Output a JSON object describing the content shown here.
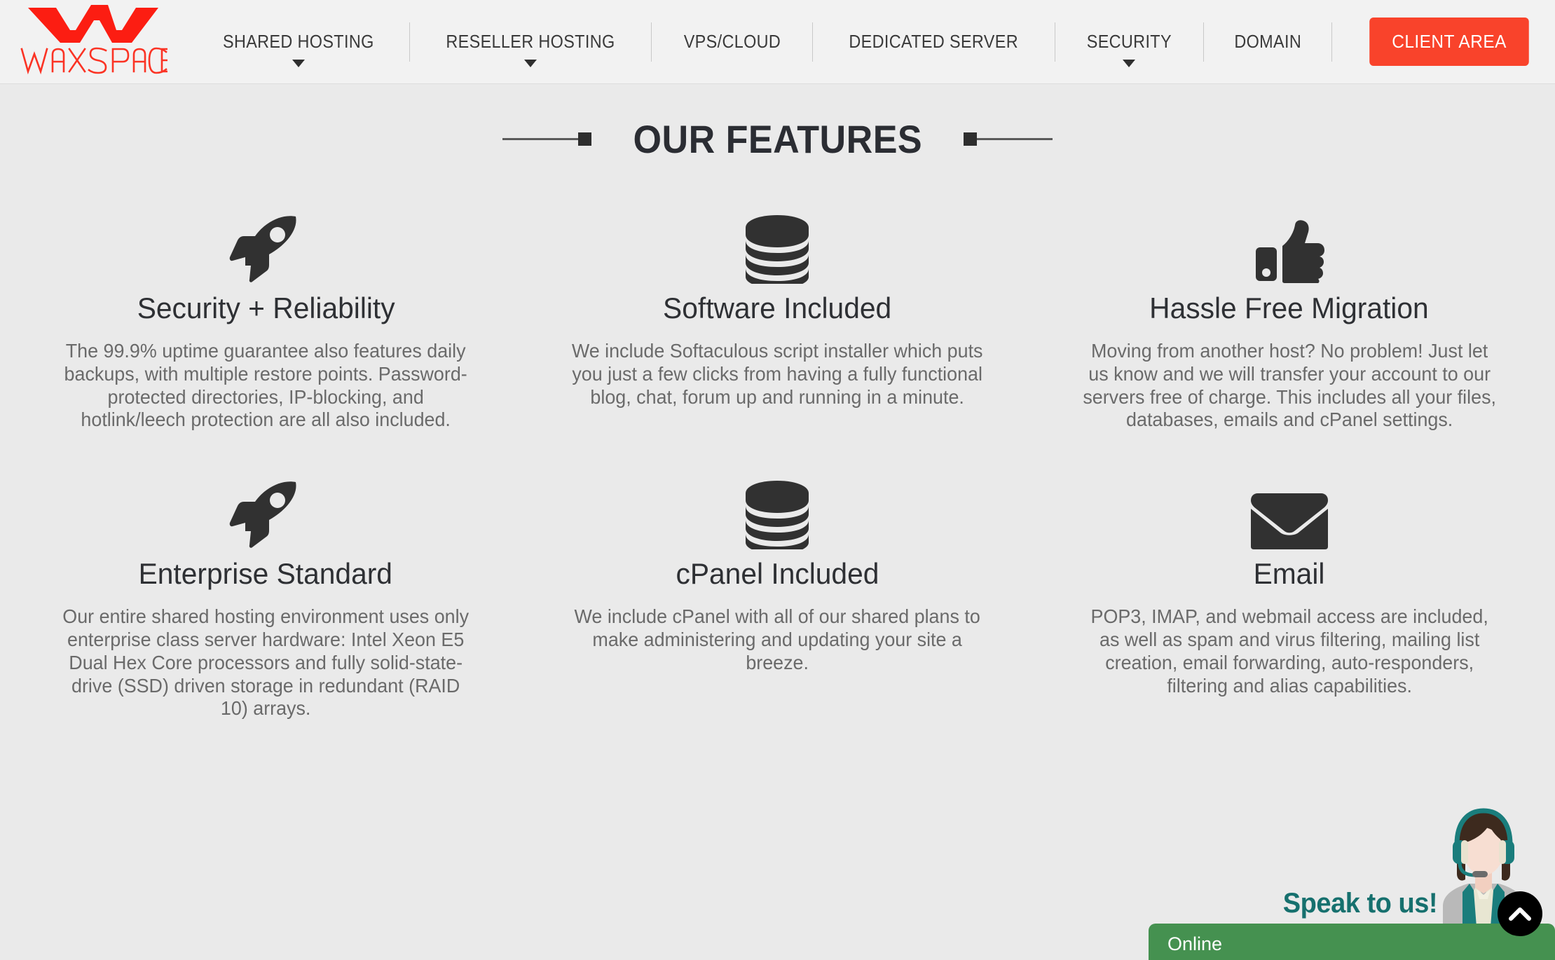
{
  "brand": {
    "name": "WAXSPACE",
    "logo_icon": "waxspace-w-mark",
    "accent_color": "#f9432b"
  },
  "header": {
    "nav_items": [
      {
        "label": "SHARED HOSTING",
        "has_dropdown": true
      },
      {
        "label": "RESELLER HOSTING",
        "has_dropdown": true
      },
      {
        "label": "VPS/CLOUD",
        "has_dropdown": false
      },
      {
        "label": "DEDICATED SERVER",
        "has_dropdown": false
      },
      {
        "label": "SECURITY",
        "has_dropdown": true
      },
      {
        "label": "DOMAIN",
        "has_dropdown": false
      }
    ],
    "client_area_label": "CLIENT AREA"
  },
  "features_section": {
    "title": "OUR FEATURES",
    "cards": [
      {
        "icon": "rocket-icon",
        "title": "Security + Reliability",
        "text": "The 99.9% uptime guarantee also features daily backups, with multiple restore points. Password-protected directories, IP-blocking, and hotlink/leech protection are all also included."
      },
      {
        "icon": "database-stack-icon",
        "title": "Software Included",
        "text": "We include Softaculous script installer which puts you just a few clicks from having a fully functional blog, chat, forum up and running in a minute."
      },
      {
        "icon": "thumbs-up-icon",
        "title": "Hassle Free Migration",
        "text": "Moving from another host? No problem! Just let us know and we will transfer your account to our servers free of charge. This includes all your files, databases, emails and cPanel settings."
      },
      {
        "icon": "rocket-icon",
        "title": "Enterprise Standard",
        "text": "Our entire shared hosting environment uses only enterprise class server hardware: Intel Xeon E5 Dual Hex Core processors and fully solid-state-drive (SSD) driven storage in redundant (RAID 10) arrays."
      },
      {
        "icon": "database-stack-icon",
        "title": "cPanel Included",
        "text": "We include cPanel with all of our shared plans to make administering and updating your site a breeze."
      },
      {
        "icon": "envelope-icon",
        "title": "Email",
        "text": "POP3, IMAP, and webmail access are included, as well as spam and virus filtering, mailing list creation, email forwarding, auto-responders, filtering and alias capabilities."
      }
    ]
  },
  "chat_widget": {
    "prompt": "Speak to us!",
    "status": "Online",
    "status_color": "#459150",
    "prompt_color": "#16706e",
    "agent_icon": "support-agent-headset-avatar",
    "scroll_top_icon": "chevron-up-icon"
  }
}
